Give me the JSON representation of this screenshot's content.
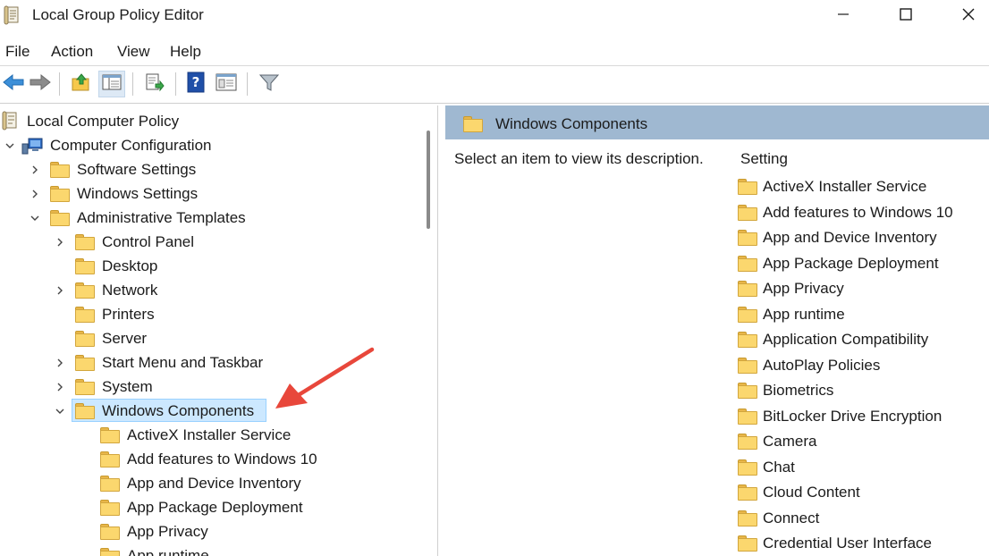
{
  "window": {
    "title": "Local Group Policy Editor",
    "icons": {
      "app": "policy-document-icon",
      "minimize": "minimize-icon",
      "maximize": "maximize-icon",
      "close": "close-icon"
    }
  },
  "menu": [
    "File",
    "Action",
    "View",
    "Help"
  ],
  "toolbar": {
    "buttons": [
      "back-arrow-icon",
      "forward-arrow-icon",
      "up-folder-icon",
      "show-hide-tree-icon",
      "export-list-icon",
      "help-icon",
      "properties-icon",
      "filter-icon"
    ]
  },
  "tree": {
    "root": "Local Computer Policy",
    "computer_configuration": "Computer Configuration",
    "software_settings": "Software Settings",
    "windows_settings": "Windows Settings",
    "administrative_templates": "Administrative Templates",
    "children": [
      "Control Panel",
      "Desktop",
      "Network",
      "Printers",
      "Server",
      "Start Menu and Taskbar",
      "System"
    ],
    "selected": "Windows Components",
    "sub_items": [
      "ActiveX Installer Service",
      "Add features to Windows 10",
      "App and Device Inventory",
      "App Package Deployment",
      "App Privacy",
      "App runtime"
    ]
  },
  "right": {
    "header_title": "Windows Components",
    "description": "Select an item to view its description.",
    "column_header": "Setting",
    "items": [
      "ActiveX Installer Service",
      "Add features to Windows 10",
      "App and Device Inventory",
      "App Package Deployment",
      "App Privacy",
      "App runtime",
      "Application Compatibility",
      "AutoPlay Policies",
      "Biometrics",
      "BitLocker Drive Encryption",
      "Camera",
      "Chat",
      "Cloud Content",
      "Connect",
      "Credential User Interface"
    ]
  },
  "colors": {
    "header_band": "#9fb8d1",
    "selection": "#cce8ff",
    "folder": "#fbd76e",
    "annotation_arrow": "#e8473b"
  }
}
